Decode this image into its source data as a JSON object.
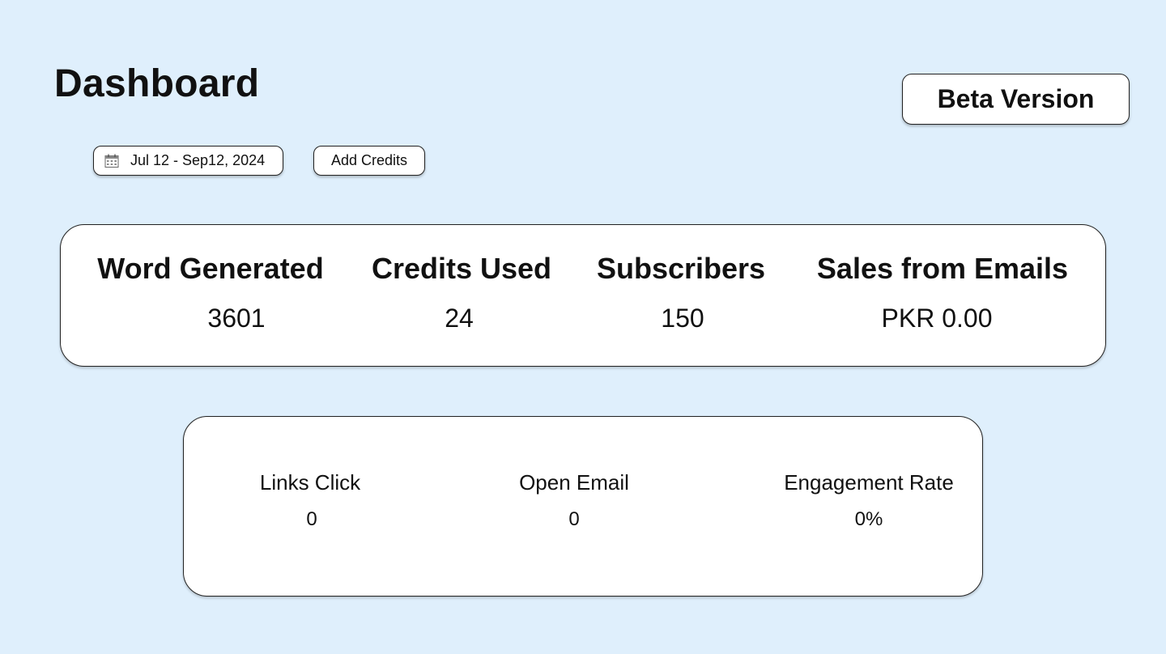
{
  "header": {
    "title": "Dashboard",
    "beta_label": "Beta Version"
  },
  "toolbar": {
    "date_range": "Jul 12 - Sep12, 2024",
    "date_icon": "calendar-icon",
    "add_credits_label": "Add Credits"
  },
  "stats": [
    {
      "label": "Word Generated",
      "value": "3601"
    },
    {
      "label": "Credits Used",
      "value": "24"
    },
    {
      "label": "Subscribers",
      "value": "150"
    },
    {
      "label": "Sales from Emails",
      "value": "PKR 0.00"
    }
  ],
  "engagement": [
    {
      "label": "Links Click",
      "value": "0"
    },
    {
      "label": "Open Email",
      "value": "0"
    },
    {
      "label": "Engagement Rate",
      "value": "0%"
    }
  ],
  "colors": {
    "background": "#dfeffc",
    "card": "#ffffff",
    "border": "#222222"
  }
}
